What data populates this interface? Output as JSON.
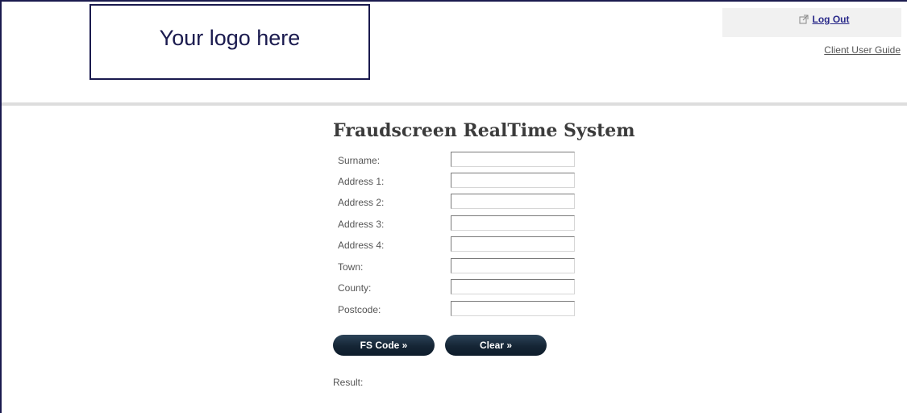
{
  "header": {
    "logo_text": "Your logo here",
    "logout_label": "Log Out",
    "guide_label": "Client User Guide"
  },
  "main": {
    "title": "Fraudscreen RealTime System",
    "fields": [
      {
        "label": "Surname:",
        "value": ""
      },
      {
        "label": "Address 1:",
        "value": ""
      },
      {
        "label": "Address 2:",
        "value": ""
      },
      {
        "label": "Address 3:",
        "value": ""
      },
      {
        "label": "Address 4:",
        "value": ""
      },
      {
        "label": "Town:",
        "value": ""
      },
      {
        "label": "County:",
        "value": ""
      },
      {
        "label": "Postcode:",
        "value": ""
      }
    ],
    "fs_code_button": "FS Code »",
    "clear_button": "Clear »",
    "result_label": "Result:"
  },
  "icons": {
    "logout": "external-link-icon"
  },
  "colors": {
    "frame": "#1a1a4e",
    "link": "#2a2a8a",
    "button": "#152535",
    "rule": "#dddddd"
  }
}
